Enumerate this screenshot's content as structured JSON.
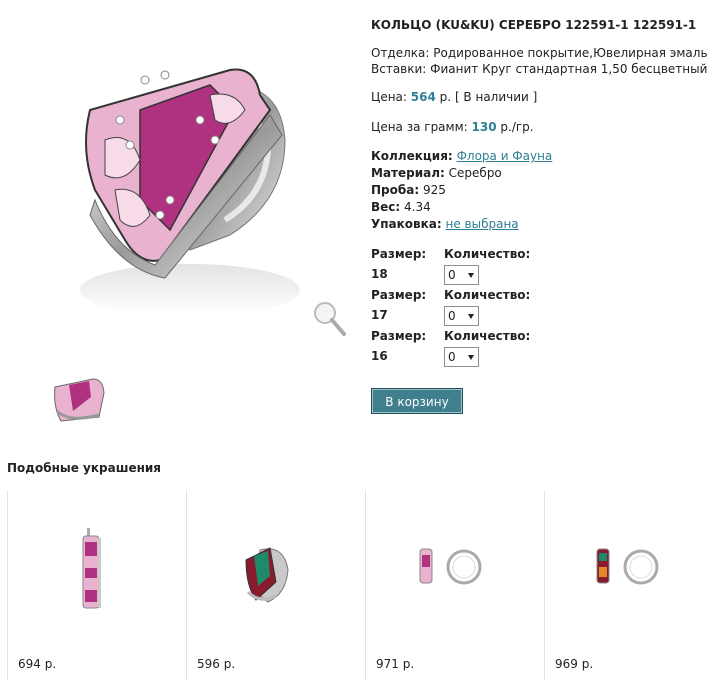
{
  "product": {
    "title": "КОЛЬЦО (KU&KU) СЕРЕБРО 122591-1 122591-1",
    "finish_label": "Отделка:",
    "finish_value": "Родированное покрытие,Ювелирная эмаль",
    "inserts_label": "Вставки:",
    "inserts_value": "Фианит Круг стандартная 1,50 бесцветный",
    "price_label": "Цена:",
    "price_value": "564",
    "price_unit": "р.",
    "stock": "[ В наличии ]",
    "ppg_label": "Цена за грамм:",
    "ppg_value": "130",
    "ppg_unit": "р./гр.",
    "collection_label": "Коллекция:",
    "collection_value": "Флора и Фауна",
    "material_label": "Материал:",
    "material_value": "Серебро",
    "proba_label": "Проба:",
    "proba_value": "925",
    "weight_label": "Вес:",
    "weight_value": "4.34",
    "pack_label": "Упаковка:",
    "pack_value": "не выбрана"
  },
  "sizes": [
    {
      "size_label": "Размер:",
      "size": "18",
      "qty_label": "Количество:",
      "qty": "0"
    },
    {
      "size_label": "Размер:",
      "size": "17",
      "qty_label": "Количество:",
      "qty": "0"
    },
    {
      "size_label": "Размер:",
      "size": "16",
      "qty_label": "Количество:",
      "qty": "0"
    }
  ],
  "cart_button": "В корзину",
  "similar": {
    "title": "Подобные украшения",
    "items": [
      {
        "price": "694 р.",
        "icon": "pendant-icon"
      },
      {
        "price": "596 р.",
        "icon": "ring-icon"
      },
      {
        "price": "971 р.",
        "icon": "earrings-icon"
      },
      {
        "price": "969 р.",
        "icon": "earrings-icon"
      }
    ]
  },
  "colors": {
    "accent": "#2f7f96",
    "button": "#3f7f8e",
    "enamel": "#b0317f",
    "enamel_light": "#f1c6dc",
    "silver": "#c9c9c9"
  }
}
